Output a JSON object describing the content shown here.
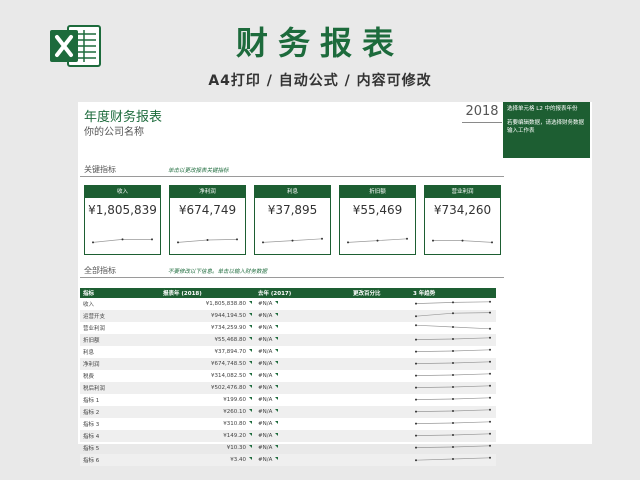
{
  "banner": {
    "title": "财务报表",
    "subtitle": "A4打印 / 自动公式 / 内容可修改",
    "logo_icon": "excel-icon",
    "accent": "#1d6b3c"
  },
  "report": {
    "title": "年度财务报表",
    "company": "你的公司名称",
    "year": "2018"
  },
  "note": {
    "line1": "选择单元格 L2 中的报表年份",
    "line2": "若要编辑数据，请选择财务数据输入工作表"
  },
  "sections": {
    "kpi_label": "关键指标",
    "kpi_hint": "单击以更改报表关键指标",
    "all_label": "全部指标",
    "all_hint": "不要修改以下信息。单击以输入财务数据"
  },
  "kpis": [
    {
      "label": "收入",
      "value": "¥1,805,839",
      "trend": [
        0.3,
        0.55,
        0.55
      ]
    },
    {
      "label": "净利润",
      "value": "¥674,749",
      "trend": [
        0.3,
        0.5,
        0.55
      ]
    },
    {
      "label": "利息",
      "value": "¥37,895",
      "trend": [
        0.3,
        0.45,
        0.6
      ]
    },
    {
      "label": "折旧额",
      "value": "¥55,469",
      "trend": [
        0.3,
        0.45,
        0.6
      ]
    },
    {
      "label": "营业利润",
      "value": "¥734,260",
      "trend": [
        0.45,
        0.45,
        0.3
      ]
    }
  ],
  "table": {
    "headers": [
      "指标",
      "报表年 (2018)",
      "去年 (2017)",
      "更改百分比",
      "3 年趋势"
    ],
    "rows": [
      {
        "label": "收入",
        "cur": "¥1,805,838.80",
        "prev": "#N/A",
        "pct": "",
        "trend": [
          0.4,
          0.6,
          0.7
        ]
      },
      {
        "label": "运营开支",
        "cur": "¥944,194.50",
        "prev": "#N/A",
        "pct": "",
        "trend": [
          0.3,
          0.8,
          0.9
        ]
      },
      {
        "label": "营业利润",
        "cur": "¥734,259.90",
        "prev": "#N/A",
        "pct": "",
        "trend": [
          0.8,
          0.5,
          0.2
        ]
      },
      {
        "label": "折旧额",
        "cur": "¥55,468.80",
        "prev": "#N/A",
        "pct": "",
        "trend": [
          0.4,
          0.5,
          0.7
        ]
      },
      {
        "label": "利息",
        "cur": "¥37,894.70",
        "prev": "#N/A",
        "pct": "",
        "trend": [
          0.4,
          0.5,
          0.7
        ]
      },
      {
        "label": "净利润",
        "cur": "¥674,748.50",
        "prev": "#N/A",
        "pct": "",
        "trend": [
          0.4,
          0.5,
          0.7
        ]
      },
      {
        "label": "税费",
        "cur": "¥314,082.50",
        "prev": "#N/A",
        "pct": "",
        "trend": [
          0.4,
          0.5,
          0.7
        ]
      },
      {
        "label": "税后利润",
        "cur": "¥502,476.80",
        "prev": "#N/A",
        "pct": "",
        "trend": [
          0.4,
          0.5,
          0.7
        ]
      },
      {
        "label": "指标 1",
        "cur": "¥199.60",
        "prev": "#N/A",
        "pct": "",
        "trend": [
          0.4,
          0.5,
          0.7
        ]
      },
      {
        "label": "指标 2",
        "cur": "¥260.10",
        "prev": "#N/A",
        "pct": "",
        "trend": [
          0.4,
          0.5,
          0.7
        ]
      },
      {
        "label": "指标 3",
        "cur": "¥310.80",
        "prev": "#N/A",
        "pct": "",
        "trend": [
          0.4,
          0.5,
          0.7
        ]
      },
      {
        "label": "指标 4",
        "cur": "¥149.20",
        "prev": "#N/A",
        "pct": "",
        "trend": [
          0.4,
          0.5,
          0.7
        ]
      },
      {
        "label": "指标 5",
        "cur": "¥10.30",
        "prev": "#N/A",
        "pct": "",
        "trend": [
          0.4,
          0.5,
          0.7
        ]
      },
      {
        "label": "指标 6",
        "cur": "¥3.40",
        "prev": "#N/A",
        "pct": "",
        "trend": [
          0.3,
          0.5,
          0.7
        ]
      }
    ]
  }
}
